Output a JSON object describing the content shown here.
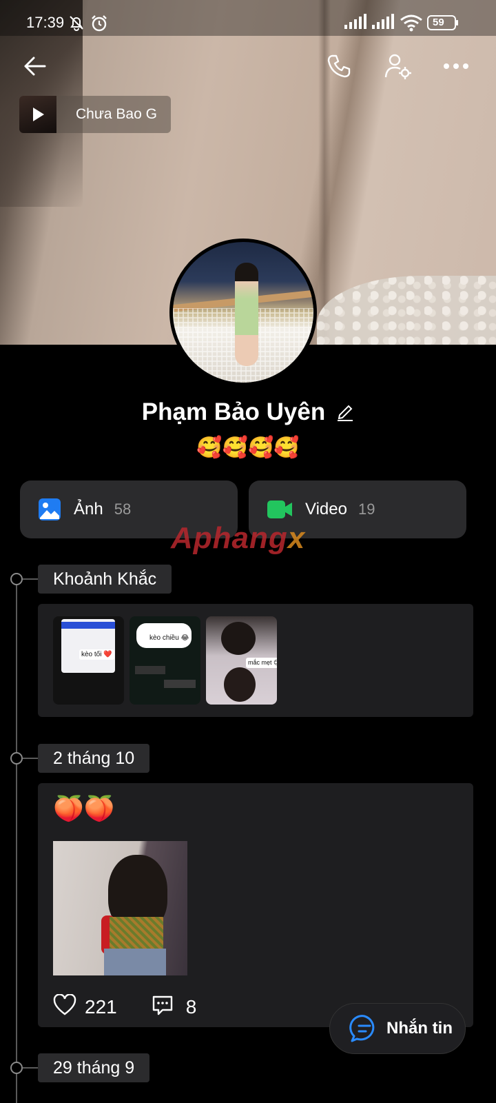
{
  "status_bar": {
    "time": "17:39",
    "battery": "59",
    "icons": [
      "mute-bell-icon",
      "alarm-icon",
      "signal-icon",
      "signal-icon",
      "wifi-icon",
      "battery-icon"
    ]
  },
  "header": {
    "icons": [
      "back-arrow-icon",
      "phone-icon",
      "user-settings-icon",
      "more-icon"
    ]
  },
  "music": {
    "title": "Chưa Bao G"
  },
  "profile": {
    "name": "Phạm Bảo Uyên",
    "bio": "🥰🥰🥰🥰"
  },
  "media": {
    "photos_label": "Ảnh",
    "photos_count": "58",
    "videos_label": "Video",
    "videos_count": "19"
  },
  "watermark": {
    "text_main": "Aphang",
    "text_x": "x"
  },
  "timeline": {
    "moments_label": "Khoảnh Khắc",
    "moment_thumbs": [
      {
        "caption": "kèo tối ❤️"
      },
      {
        "caption": "kèo chiều 😂"
      },
      {
        "caption": "mắc mẹt 😊"
      }
    ],
    "post1": {
      "date": "2 tháng 10",
      "text": "🍑🍑",
      "likes": "221",
      "comments": "8"
    },
    "post2": {
      "date": "29 tháng 9"
    }
  },
  "message_button": {
    "label": "Nhắn tin"
  },
  "colors": {
    "background": "#000000",
    "card": "#1e1e20",
    "button": "#2b2b2d",
    "photo_icon": "#1f7cf2",
    "video_icon": "#22c55e",
    "chat_icon": "#2a8bff"
  }
}
